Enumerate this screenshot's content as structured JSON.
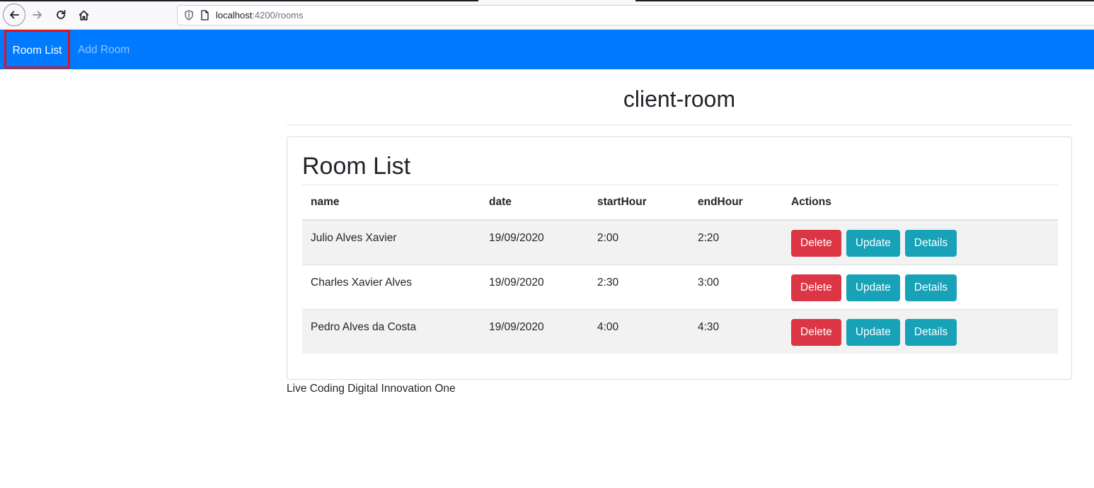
{
  "browser": {
    "url_host": "localhost",
    "url_rest": ":4200/rooms"
  },
  "navbar": {
    "items": [
      {
        "label": "Room List"
      },
      {
        "label": "Add Room"
      }
    ]
  },
  "page": {
    "heading": "client-room",
    "card_title": "Room List",
    "footer": "Live Coding Digital Innovation One"
  },
  "table": {
    "headers": [
      "name",
      "date",
      "startHour",
      "endHour",
      "Actions"
    ],
    "rows": [
      {
        "name": "Julio Alves Xavier",
        "date": "19/09/2020",
        "start": "2:00",
        "end": "2:20"
      },
      {
        "name": "Charles Xavier Alves",
        "date": "19/09/2020",
        "start": "2:30",
        "end": "3:00"
      },
      {
        "name": "Pedro Alves da Costa",
        "date": "19/09/2020",
        "start": "4:00",
        "end": "4:30"
      }
    ],
    "actions": {
      "delete": "Delete",
      "update": "Update",
      "details": "Details"
    }
  },
  "colors": {
    "navbar": "#007bff",
    "delete": "#dc3545",
    "info": "#17a2b8",
    "highlight": "#e0131a"
  },
  "icons": [
    "back-arrow-icon",
    "forward-arrow-icon",
    "reload-icon",
    "home-icon",
    "shield-icon",
    "page-icon"
  ]
}
